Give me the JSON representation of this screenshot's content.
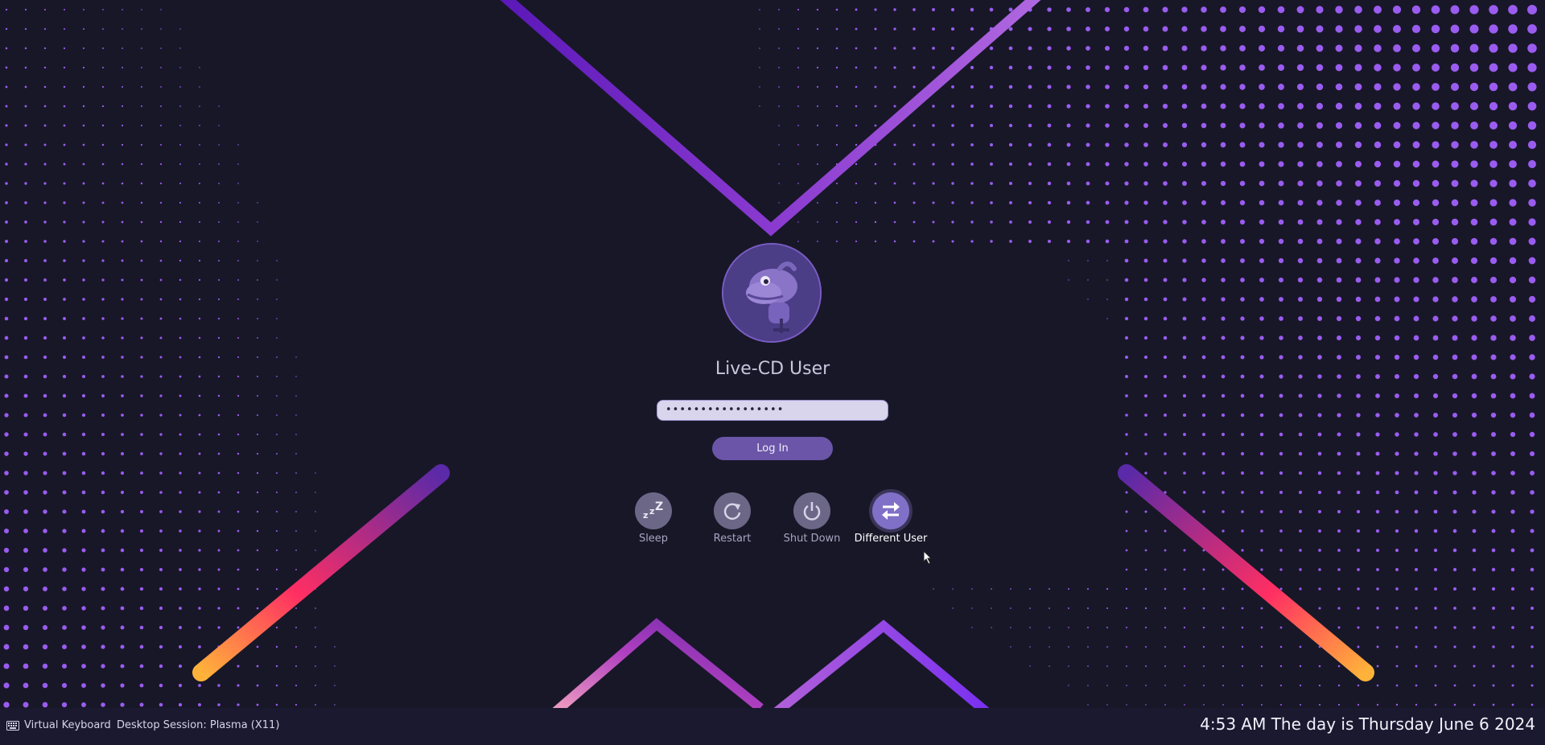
{
  "user": {
    "name": "Live-CD User",
    "password_mask": "•••••••••••••••••"
  },
  "login": {
    "label": "Log In"
  },
  "actions": [
    {
      "label": "Sleep",
      "icon": "sleep-icon"
    },
    {
      "label": "Restart",
      "icon": "restart-icon"
    },
    {
      "label": "Shut Down",
      "icon": "power-icon"
    },
    {
      "label": "Different User",
      "icon": "switch-user-icon"
    }
  ],
  "bottombar": {
    "virtual_keyboard": "Virtual Keyboard",
    "session": "Desktop Session: Plasma (X11)",
    "clock": "4:53 AM The day is Thursday June 6 2024"
  },
  "colors": {
    "background": "#181728",
    "dot": "#9a5cf0",
    "accent": "#6a55a8",
    "gradient_start": "#ffb23a",
    "gradient_mid": "#ff2e63",
    "gradient_end": "#5a2aa8"
  }
}
